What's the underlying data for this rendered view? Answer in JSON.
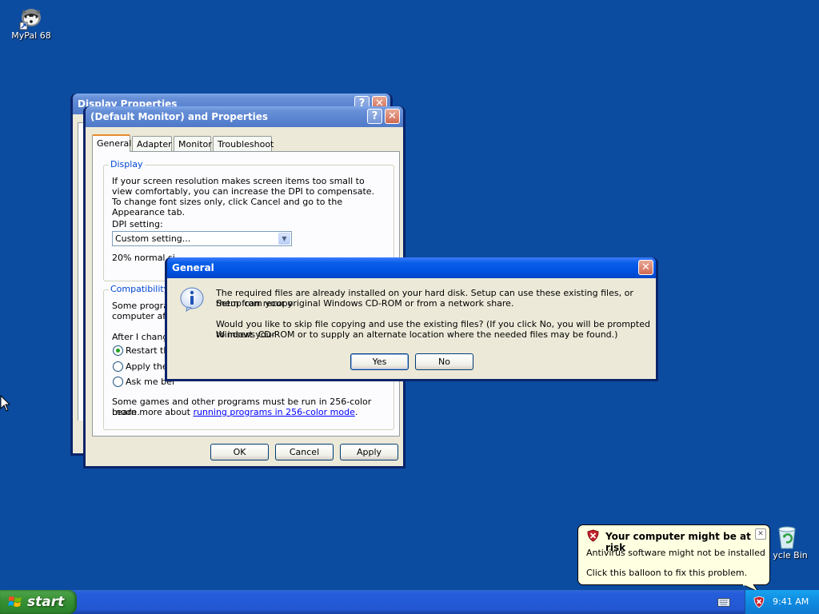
{
  "desktop": {
    "icons": [
      {
        "label": "MyPal 68"
      },
      {
        "label": "ycle Bin"
      }
    ]
  },
  "display_props": {
    "title": "Display Properties",
    "help": "?",
    "close": "✕"
  },
  "monitor_props": {
    "title": "(Default Monitor) and  Properties",
    "help": "?",
    "close": "✕",
    "tabs": [
      "General",
      "Adapter",
      "Monitor",
      "Troubleshoot"
    ],
    "display_group": {
      "label": "Display",
      "text": "If your screen resolution makes screen items too small to view comfortably, you can increase the DPI to compensate.  To change font sizes only, click Cancel and go to the Appearance tab.",
      "dpi_label": "DPI setting:",
      "dpi_value": "Custom setting...",
      "normal_size_text": "20% normal si"
    },
    "compat_group": {
      "label": "Compatibility",
      "text_line1": "Some program",
      "text_line2": "computer afte",
      "after_label": "After I change",
      "options": [
        "Restart the",
        "Apply the n",
        "Ask me bef"
      ],
      "note_line1": "Some games and other programs must be run in 256-color mode.",
      "note_prefix": "Learn more about ",
      "note_link": "running programs in 256-color mode",
      "note_suffix": "."
    },
    "buttons": {
      "ok": "OK",
      "cancel": "Cancel",
      "apply": "Apply"
    }
  },
  "dialog": {
    "title": "General",
    "close": "✕",
    "icon": "info-icon",
    "para1_line1": "The required files are already installed on your hard disk. Setup can use these existing files, or Setup can recopy",
    "para1_line2": "them from your original Windows CD-ROM or from a network share.",
    "para2_line1": "Would you like to skip file copying and use the existing files? (If you click No, you will be prompted to insert your",
    "para2_line2": "Windows CD-ROM or to supply an alternate location where the needed files may be found.)",
    "yes": "Yes",
    "no": "No"
  },
  "balloon": {
    "title": "Your computer might be at risk",
    "line1": "Antivirus software might not be installed",
    "line2": "Click this balloon to fix this problem.",
    "close": "✕"
  },
  "taskbar": {
    "start_label": "start",
    "clock": "9:41 AM"
  }
}
